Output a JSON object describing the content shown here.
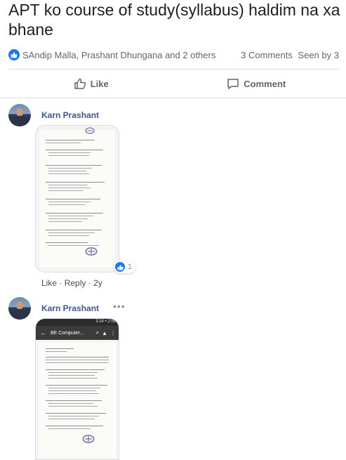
{
  "post": {
    "title": "APT ko course of study(syllabus) haldim na xa bhane",
    "reactors": "SAndip Malla, Prashant Dhungana and 2 others",
    "comments_count": "3 Comments",
    "seen_by": "Seen by 3"
  },
  "actions": {
    "like": "Like",
    "comment": "Comment"
  },
  "comments": [
    {
      "author": "Karn Prashant",
      "reaction_count": "1",
      "like_label": "Like",
      "reply_label": "Reply",
      "time": "2y"
    },
    {
      "author": "Karn Prashant",
      "screenshot_header": "BE Computer...",
      "status_bar": "3:14 • 2:56"
    }
  ],
  "colors": {
    "link": "#385898",
    "like_blue": "#1877f2",
    "muted": "#606770"
  }
}
